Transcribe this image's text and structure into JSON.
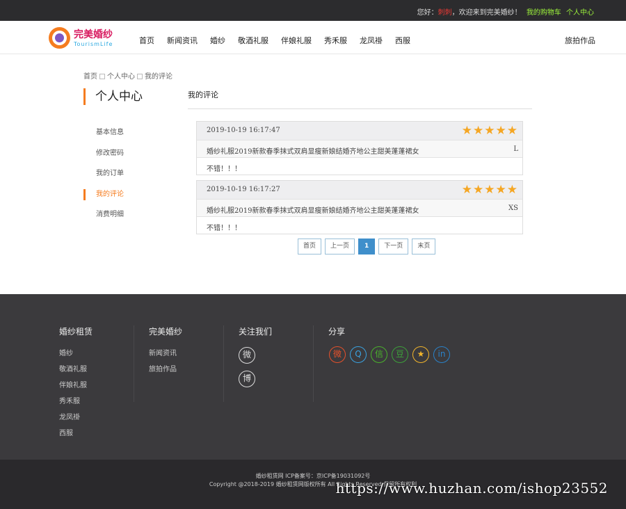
{
  "topbar": {
    "greeting": "您好：",
    "username": "刺刺",
    "welcome": "，欢迎来到完美婚纱！",
    "cart": "我的购物车",
    "center": "个人中心"
  },
  "logo": {
    "cn": "完美婚纱",
    "en": "TourismLife"
  },
  "nav": {
    "items": [
      "首页",
      "新闻资讯",
      "婚纱",
      "敬酒礼服",
      "伴娘礼服",
      "秀禾服",
      "龙凤褂",
      "西服"
    ],
    "right": "旅拍作品"
  },
  "breadcrumb": [
    "首页",
    "个人中心",
    "我的评论"
  ],
  "sidebar": {
    "title": "个人中心",
    "items": [
      "基本信息",
      "修改密码",
      "我的订单",
      "我的评论",
      "消费明细"
    ],
    "active": 3
  },
  "main": {
    "title": "我的评论",
    "comments": [
      {
        "date": "2019-10-19  16:17:47",
        "stars": "★★★★★",
        "product": "婚纱礼服2019新款春季抹式双肩显瘦新娘结婚齐地公主甜美蓬蓬裙女",
        "size": "L",
        "content": "不错！！！"
      },
      {
        "date": "2019-10-19  16:17:27",
        "stars": "★★★★★",
        "product": "婚纱礼服2019新款春季抹式双肩显瘦新娘结婚齐地公主甜美蓬蓬裙女",
        "size": "XS",
        "content": "不错！！！"
      }
    ]
  },
  "pager": {
    "first": "首页",
    "prev": "上一页",
    "current": "1",
    "next": "下一页",
    "last": "末页"
  },
  "footer": {
    "cols": [
      {
        "title": "婚纱租赁",
        "links": [
          "婚纱",
          "敬酒礼服",
          "伴娘礼服",
          "秀禾服",
          "龙凤褂",
          "西服"
        ]
      },
      {
        "title": "完美婚纱",
        "links": [
          "新闻资讯",
          "旅拍作品"
        ]
      },
      {
        "title": "关注我们",
        "icons": [
          "wechat-icon",
          "weibo-icon"
        ]
      },
      {
        "title": "分享"
      }
    ],
    "share_icons": [
      {
        "name": "weibo-icon",
        "glyph": "微",
        "color": "#e6512b"
      },
      {
        "name": "qq-icon",
        "glyph": "Q",
        "color": "#3aa2e0"
      },
      {
        "name": "wechat-icon",
        "glyph": "信",
        "color": "#4ab22c"
      },
      {
        "name": "douban-icon",
        "glyph": "豆",
        "color": "#3da13a"
      },
      {
        "name": "qzone-icon",
        "glyph": "★",
        "color": "#f2b52c"
      },
      {
        "name": "linkedin-icon",
        "glyph": "in",
        "color": "#2a82c9"
      }
    ],
    "wechat_glyph": "微",
    "weibo_glyph": "博",
    "icp": "婚纱租赁网 ICP备案号：京ICP备19031092号",
    "copyright": "Copyright @2018-2019 婚纱租赁网版权所有 All Rights Reserved 保留所有权利"
  },
  "watermark": "https://www.huzhan.com/ishop23552"
}
